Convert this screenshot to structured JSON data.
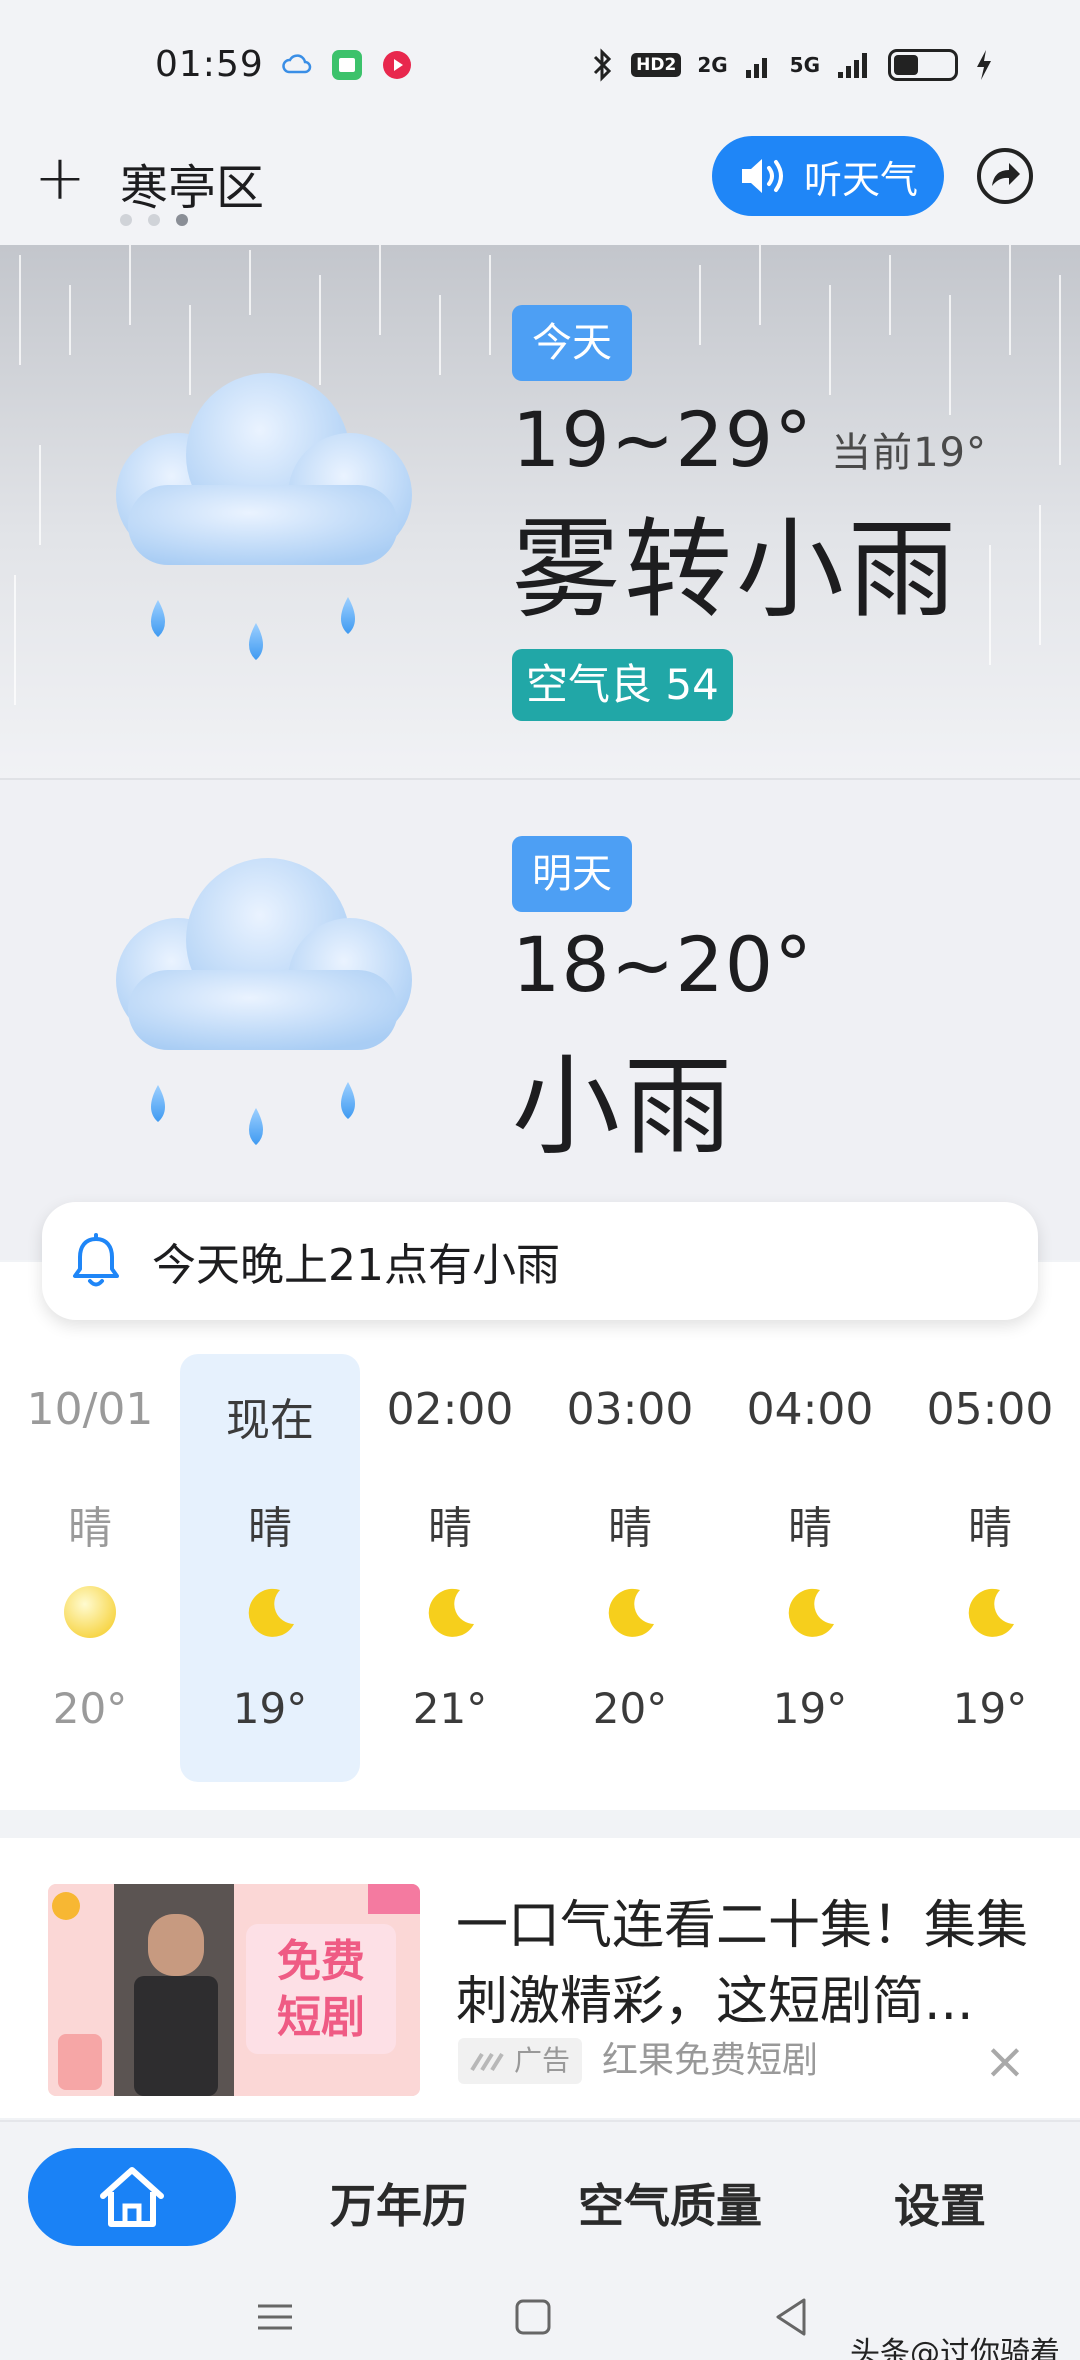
{
  "status_bar": {
    "time": "01:59",
    "hd_label": "HD2",
    "net1": "2G",
    "net2": "5G"
  },
  "header": {
    "add_label": "+",
    "city": "寒亭区",
    "listen_label": "听天气",
    "page_count": 3,
    "active_page": 3
  },
  "today": {
    "badge": "今天",
    "temp_range": "19~29°",
    "current": "当前19°",
    "condition": "雾转小雨",
    "aqi": "空气良 54",
    "icon": "rain-cloud-icon"
  },
  "tomorrow": {
    "badge": "明天",
    "temp_range": "18~20°",
    "condition": "小雨",
    "icon": "rain-cloud-icon"
  },
  "alert": {
    "icon": "bell-icon",
    "text": "今天晚上21点有小雨"
  },
  "hourly": [
    {
      "time": "10/01",
      "cond": "晴",
      "temp": "20°",
      "icon": "sun-icon",
      "state": "past"
    },
    {
      "time": "现在",
      "cond": "晴",
      "temp": "19°",
      "icon": "moon-icon",
      "state": "current"
    },
    {
      "time": "02:00",
      "cond": "晴",
      "temp": "21°",
      "icon": "moon-icon",
      "state": "future"
    },
    {
      "time": "03:00",
      "cond": "晴",
      "temp": "20°",
      "icon": "moon-icon",
      "state": "future"
    },
    {
      "time": "04:00",
      "cond": "晴",
      "temp": "19°",
      "icon": "moon-icon",
      "state": "future"
    },
    {
      "time": "05:00",
      "cond": "晴",
      "temp": "19°",
      "icon": "moon-icon",
      "state": "future"
    }
  ],
  "ad": {
    "title": "一口气连看二十集！集集刺激精彩，这短剧简...",
    "tag": "广告",
    "source": "红果免费短剧",
    "image_text_1": "免费",
    "image_text_2": "短剧",
    "close": "×"
  },
  "bottom_nav": {
    "home_icon": "home-icon",
    "calendar": "万年历",
    "air_quality": "空气质量",
    "settings": "设置"
  },
  "watermark": "头条@过你骑着",
  "colors": {
    "accent": "#1a82f6",
    "badge_blue": "#4d9ff4",
    "aqi_teal": "#21a7a7",
    "current_hour_bg": "#e6f1fd"
  }
}
